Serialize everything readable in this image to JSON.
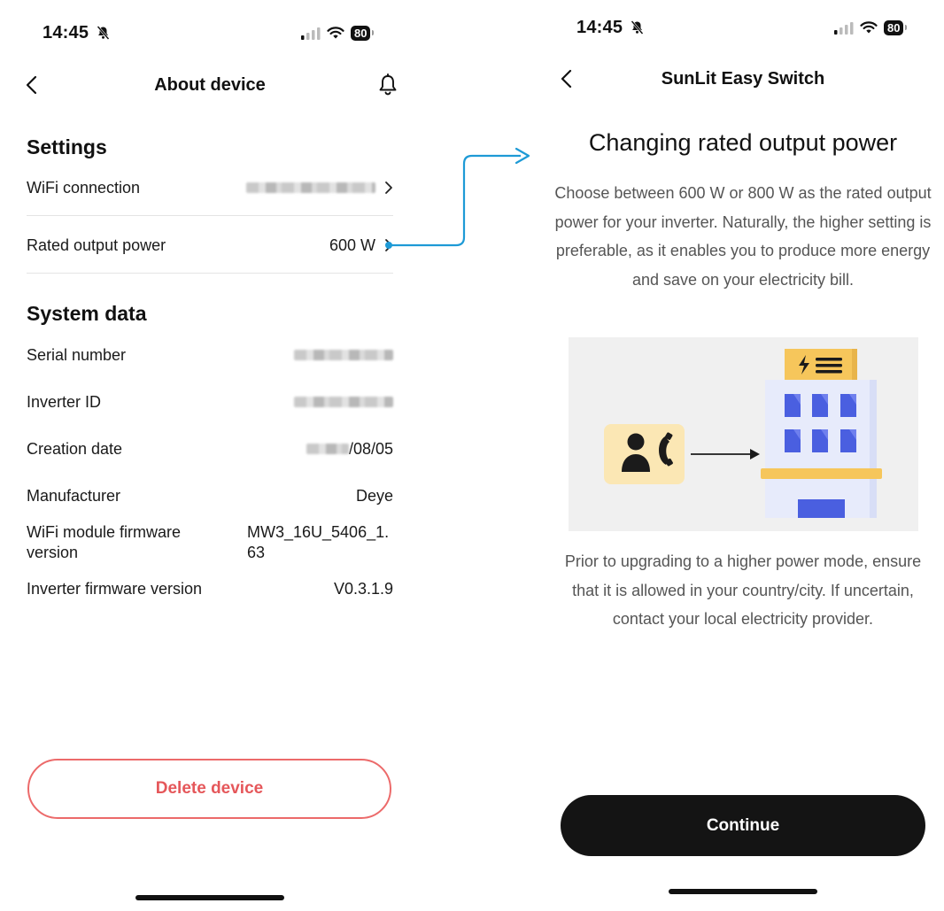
{
  "left": {
    "status": {
      "time": "14:45",
      "battery": "80"
    },
    "nav": {
      "title": "About device"
    },
    "settings": {
      "title": "Settings",
      "wifi_label": "WiFi connection",
      "rated_label": "Rated output power",
      "rated_value": "600 W"
    },
    "system": {
      "title": "System data",
      "serial_label": "Serial number",
      "inverter_id_label": "Inverter ID",
      "creation_label": "Creation date",
      "creation_value_visible": "/08/05",
      "manufacturer_label": "Manufacturer",
      "manufacturer_value": "Deye",
      "wifi_fw_label": "WiFi module firmware version",
      "wifi_fw_value": "MW3_16U_5406_1.63",
      "inverter_fw_label": "Inverter firmware version",
      "inverter_fw_value": "V0.3.1.9"
    },
    "delete_label": "Delete device"
  },
  "right": {
    "status": {
      "time": "14:45",
      "battery": "80"
    },
    "nav": {
      "title": "SunLit Easy Switch"
    },
    "heading": "Changing rated output power",
    "intro": "Choose between 600 W or 800 W as the rated output power for your inverter. Naturally, the higher setting is preferable, as it enables you to produce more energy and save on your electricity bill.",
    "notice": "Prior to upgrading to a higher power mode, ensure that it is allowed in your country/city. If uncertain, contact your local electricity provider.",
    "continue_label": "Continue"
  },
  "icons": {
    "back": "chevron-left-icon",
    "bell": "bell-icon",
    "chevron": "chevron-right-icon",
    "muted": "bell-slash-icon",
    "wifi": "wifi-icon",
    "signal": "cellular-signal-icon"
  },
  "colors": {
    "accent_red": "#e5575a",
    "connector_blue": "#1e9ad6",
    "continue_bg": "#141414",
    "illustration_yellow": "#f6c65b",
    "illustration_blue": "#4a5fe0"
  }
}
